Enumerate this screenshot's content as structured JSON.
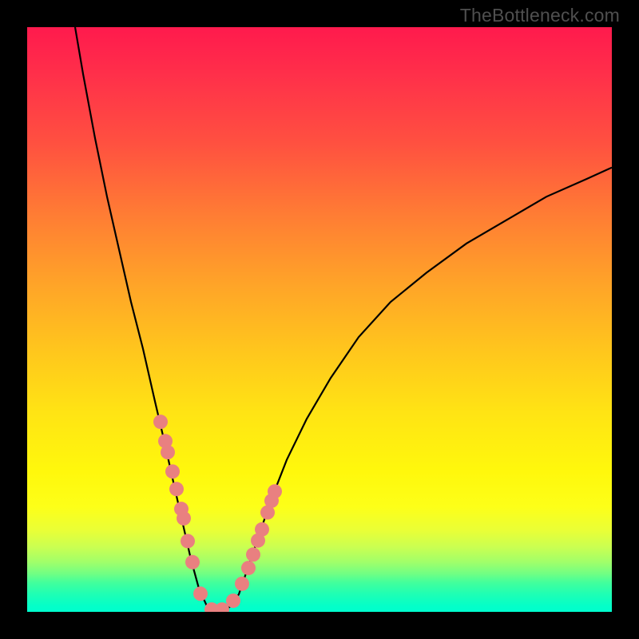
{
  "watermark": "TheBottleneck.com",
  "colors": {
    "frame": "#000000",
    "curve_stroke": "#000000",
    "dot_fill": "#e98080",
    "watermark_text": "#4f4f4f"
  },
  "chart_data": {
    "type": "line",
    "title": "",
    "xlabel": "",
    "ylabel": "",
    "xlim": [
      0,
      732
    ],
    "ylim": [
      0,
      100
    ],
    "description": "V-shaped bottleneck curve on a vertical red-to-green gradient background. Y value = severity (0% optimal at bottom, 100% severe at top). Curve reaches minimum (0%) around x≈215–255, rises steeply on left side to 100% at x≈60, rises more gradually on right side to ~76% at x=732.",
    "series": [
      {
        "name": "curve",
        "x": [
          60,
          70,
          85,
          100,
          115,
          130,
          145,
          160,
          172,
          185,
          195,
          205,
          215,
          225,
          235,
          245,
          255,
          265,
          275,
          290,
          305,
          325,
          350,
          380,
          415,
          455,
          500,
          550,
          600,
          650,
          700,
          732
        ],
        "y": [
          100,
          92,
          81,
          71,
          62,
          53,
          45,
          36,
          29,
          21,
          15,
          9,
          4,
          1,
          0,
          0,
          1,
          3,
          7,
          13,
          19,
          26,
          33,
          40,
          47,
          53,
          58,
          63,
          67,
          71,
          74,
          76
        ]
      }
    ],
    "markers": {
      "name": "dots",
      "radius": 9,
      "x": [
        167,
        173,
        176,
        182,
        187,
        193,
        196,
        201,
        207,
        217,
        231,
        244,
        258,
        269,
        277,
        283,
        289,
        294,
        301,
        306,
        310
      ],
      "y": [
        32.5,
        29.2,
        27.3,
        24.0,
        21.0,
        17.6,
        16.0,
        12.1,
        8.5,
        3.1,
        0.4,
        0.4,
        1.9,
        4.8,
        7.5,
        9.8,
        12.2,
        14.1,
        17.0,
        19.0,
        20.6
      ]
    }
  }
}
